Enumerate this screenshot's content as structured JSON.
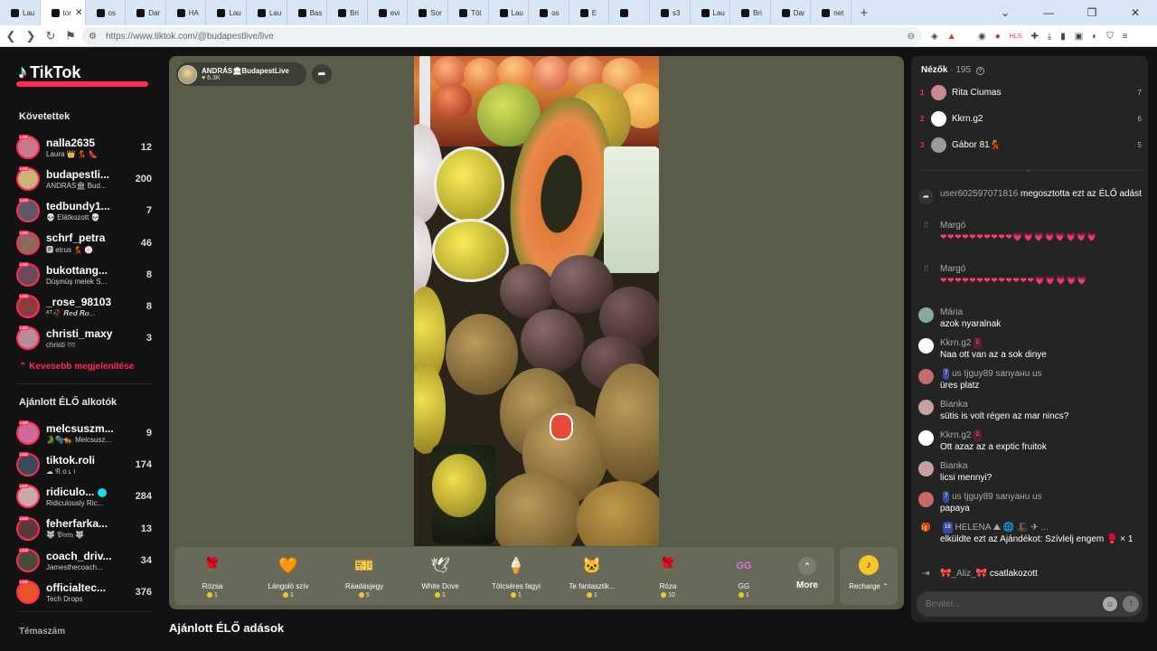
{
  "browser": {
    "tabs": [
      "Lau",
      "tor",
      "os",
      "Dar",
      "HA",
      "Lau",
      "Lau",
      "Bas",
      "Bri",
      "evi",
      "Sor",
      "Töt",
      "Lau",
      "os",
      "E",
      "",
      "s3",
      "Lau",
      "Bri",
      "Dar",
      "net"
    ],
    "url": "https://www.tiktok.com/@budapestlive/live"
  },
  "sidebar": {
    "logo": "TikTok",
    "following_title": "Követettek",
    "following": [
      {
        "name": "nalla2635",
        "sub": "Laura 👑 💃 👠",
        "count": "12",
        "color": "#c97a8a"
      },
      {
        "name": "budapestli...",
        "sub": "ANDRÁS🏛 Bud...",
        "count": "200",
        "color": "#c9b37a"
      },
      {
        "name": "tedbundy1...",
        "sub": "💀 Elátkozott 💀",
        "count": "7",
        "color": "#5a5a6a"
      },
      {
        "name": "schrf_petra",
        "sub": "🅿 etrus 💃 🍥",
        "count": "46",
        "color": "#8a6a5a"
      },
      {
        "name": "bukottang...",
        "sub": "Düşmüş melek S...",
        "count": "8",
        "color": "#6a4a5a"
      },
      {
        "name": "_rose_98103",
        "sub": "ᴬᵀ🥀 𝑹𝒆𝒅 𝑹𝒐...",
        "count": "8",
        "color": "#8a3a3a"
      },
      {
        "name": "christi_maxy",
        "sub": "christi ➿",
        "count": "3",
        "color": "#b88a9a"
      }
    ],
    "show_less": "Kevesebb megjelenítése",
    "recommended_title": "Ajánlott ÉLŐ alkotók",
    "recommended": [
      {
        "name": "melcsuszm...",
        "sub": "🐊🫧🐅 Melcsusz...",
        "count": "9",
        "color": "#d06a9a"
      },
      {
        "name": "tiktok.roli",
        "sub": "☁ 𝔑 o ʟ 𝔦",
        "count": "174",
        "color": "#3a4a5a"
      },
      {
        "name": "ridiculo...",
        "sub": "Ridiculously Ric...",
        "count": "284",
        "color": "#c8a8a8"
      },
      {
        "name": "feherfarka...",
        "sub": "🐺 𝔓𝔦𝔫𝔱𝔶 🐺",
        "count": "13",
        "color": "#5a3a3a"
      },
      {
        "name": "coach_driv...",
        "sub": "Jamesthecoach...",
        "count": "34",
        "color": "#4a4a3a"
      },
      {
        "name": "officialtec...",
        "sub": "Tech Drops",
        "count": "376",
        "color": "#e8542a"
      }
    ],
    "cut_label": "Témaszám"
  },
  "stream": {
    "host_name": "ANDRÁS🏛BudapestLive",
    "host_likes": "♥ 6.3K",
    "gifts": [
      {
        "name": "Rózsa",
        "price": "1",
        "icon": "🌹"
      },
      {
        "name": "Lángoló szív",
        "price": "1",
        "icon": "🧡"
      },
      {
        "name": "Ráadásjegy",
        "price": "5",
        "icon": "🎫"
      },
      {
        "name": "White Dove",
        "price": "1",
        "icon": "🕊"
      },
      {
        "name": "Tölcséres fagyi",
        "price": "1",
        "icon": "🍦"
      },
      {
        "name": "Te fantasztik...",
        "price": "1",
        "icon": "🐱"
      },
      {
        "name": "Róza",
        "price": "10",
        "icon": "🌹"
      },
      {
        "name": "GG",
        "price": "1",
        "icon": "GG"
      }
    ],
    "more_label": "More",
    "recharge_label": "Recharge ⌃"
  },
  "below_title": "Ajánlott ÉLŐ adások",
  "chat": {
    "viewers_label": "Nézők",
    "viewers_count": "· 195",
    "top_viewers": [
      {
        "rank": "1",
        "name": "Rita Ciumas",
        "score": "7",
        "color": "#c88a8a"
      },
      {
        "rank": "2",
        "name": "Kkrn.g2",
        "score": "6",
        "color": "#ffffff"
      },
      {
        "rank": "3",
        "name": "Gábor 81💃",
        "score": "5",
        "color": "#9a9a9a"
      }
    ],
    "messages": [
      {
        "user": "user602597071816",
        "text": "megosztotta ezt az ÉLŐ adást",
        "kind": "share"
      },
      {
        "user": "Margó",
        "hearts": "❤❤❤❤❤❤❤❤❤❤💗💗💗💗💗💗💗💗",
        "kind": "hearts"
      },
      {
        "user": "Margó",
        "hearts": "❤❤❤❤❤❤❤❤❤❤❤❤❤💗💗💗💗💗",
        "kind": "hearts"
      },
      {
        "user": "Mária",
        "text": "azok nyaralnak",
        "kind": "msg",
        "color": "#8aa89a"
      },
      {
        "user": "Kkrn.g2",
        "badge": "2.",
        "text": "Naa ott van az a sok dinye",
        "kind": "msg",
        "color": "#ffffff"
      },
      {
        "user": "us tjguy89 sanyaнu us",
        "badge_blue": "7",
        "text": "üres platz",
        "kind": "msg",
        "color": "#c86a6a"
      },
      {
        "user": "Bianka",
        "text": "sütis is volt régen az mar nincs?",
        "kind": "msg",
        "color": "#c8a0a0"
      },
      {
        "user": "Kkrn.g2",
        "badge": "2.",
        "text": "Ott azaz az a exptic fruitok",
        "kind": "msg",
        "color": "#ffffff"
      },
      {
        "user": "Bianka",
        "text": "licsi mennyi?",
        "kind": "msg",
        "color": "#c8a0a0"
      },
      {
        "user": "us tjguy89 sanyaнu us",
        "badge_blue": "7",
        "text": "papaya",
        "kind": "msg",
        "color": "#c86a6a"
      },
      {
        "user": "HELENA ⛰ 🌐 🎩 ✈ ...",
        "badge_blue": "18",
        "text": "elküldte ezt az Ajándékot: Szívlelj engem 🥊 × 1",
        "kind": "gift"
      },
      {
        "user": "🎀_Aliz_🎀",
        "text": "csatlakozott",
        "kind": "join"
      }
    ],
    "input_placeholder": "Bevitel..."
  }
}
